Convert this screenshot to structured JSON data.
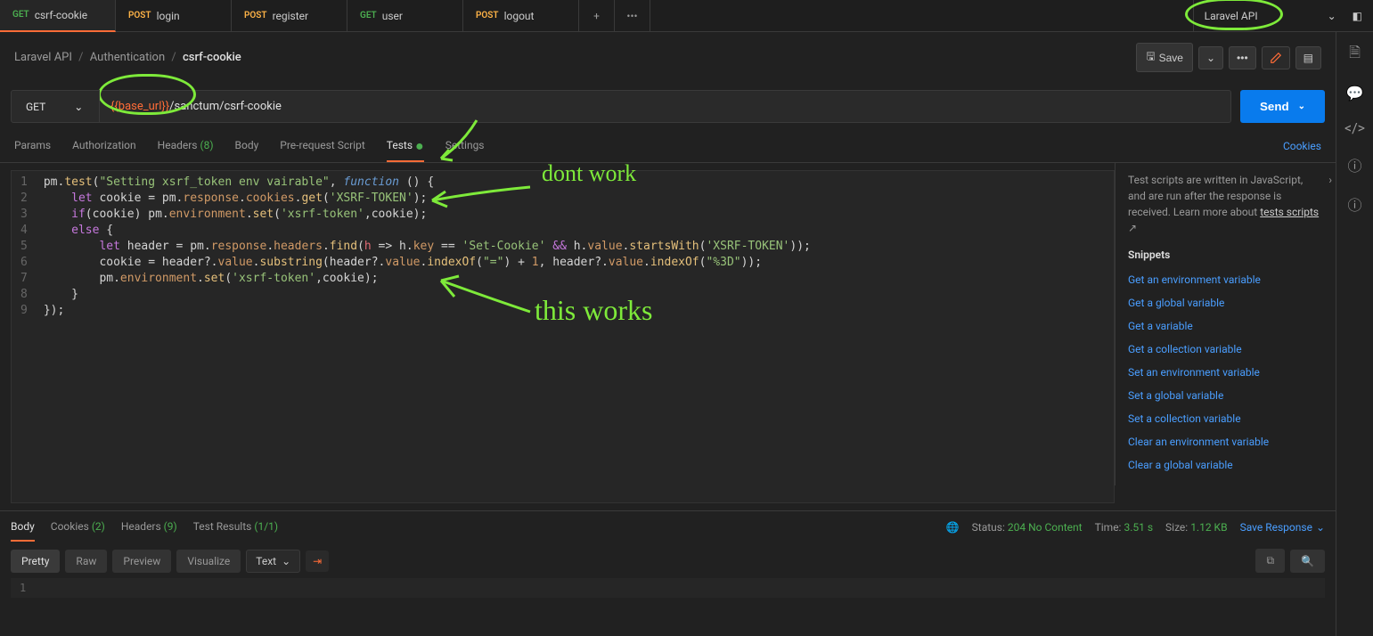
{
  "tabs": [
    {
      "method": "GET",
      "methodClass": "method-get",
      "name": "csrf-cookie",
      "active": true
    },
    {
      "method": "POST",
      "methodClass": "method-post",
      "name": "login"
    },
    {
      "method": "POST",
      "methodClass": "method-post",
      "name": "register"
    },
    {
      "method": "GET",
      "methodClass": "method-get",
      "name": "user"
    },
    {
      "method": "POST",
      "methodClass": "method-post",
      "name": "logout"
    }
  ],
  "environment": "Laravel API",
  "breadcrumb": {
    "root": "Laravel API",
    "folder": "Authentication",
    "current": "csrf-cookie"
  },
  "actions": {
    "save": "Save"
  },
  "request": {
    "method": "GET",
    "url_var": "{{base_url}}",
    "url_path": "/sanctum/csrf-cookie",
    "send": "Send"
  },
  "reqTabs": {
    "params": "Params",
    "auth": "Authorization",
    "headers": "Headers",
    "headersCount": "(8)",
    "body": "Body",
    "prerequest": "Pre-request Script",
    "tests": "Tests",
    "settings": "Settings",
    "cookies": "Cookies"
  },
  "code": {
    "lines": [
      "1",
      "2",
      "3",
      "4",
      "5",
      "6",
      "7",
      "8",
      "9"
    ]
  },
  "sidebar": {
    "desc1": "Test scripts are written in JavaScript, and are run after the response is received. Learn more about",
    "link": "tests scripts",
    "snippetsTitle": "Snippets",
    "snippets": [
      "Get an environment variable",
      "Get a global variable",
      "Get a variable",
      "Get a collection variable",
      "Set an environment variable",
      "Set a global variable",
      "Set a collection variable",
      "Clear an environment variable",
      "Clear a global variable"
    ]
  },
  "respTabs": {
    "body": "Body",
    "cookies": "Cookies",
    "cookiesCount": "(2)",
    "headers": "Headers",
    "headersCount": "(9)",
    "testResults": "Test Results",
    "testResultsCount": "(1/1)"
  },
  "status": {
    "statusLabel": "Status:",
    "statusValue": "204 No Content",
    "timeLabel": "Time:",
    "timeValue": "3.51 s",
    "sizeLabel": "Size:",
    "sizeValue": "1.12 KB",
    "saveResponse": "Save Response"
  },
  "respToolbar": {
    "pretty": "Pretty",
    "raw": "Raw",
    "preview": "Preview",
    "visualize": "Visualize",
    "format": "Text"
  },
  "annotations": {
    "dontwork": "dont work",
    "thisworks": "this works"
  }
}
